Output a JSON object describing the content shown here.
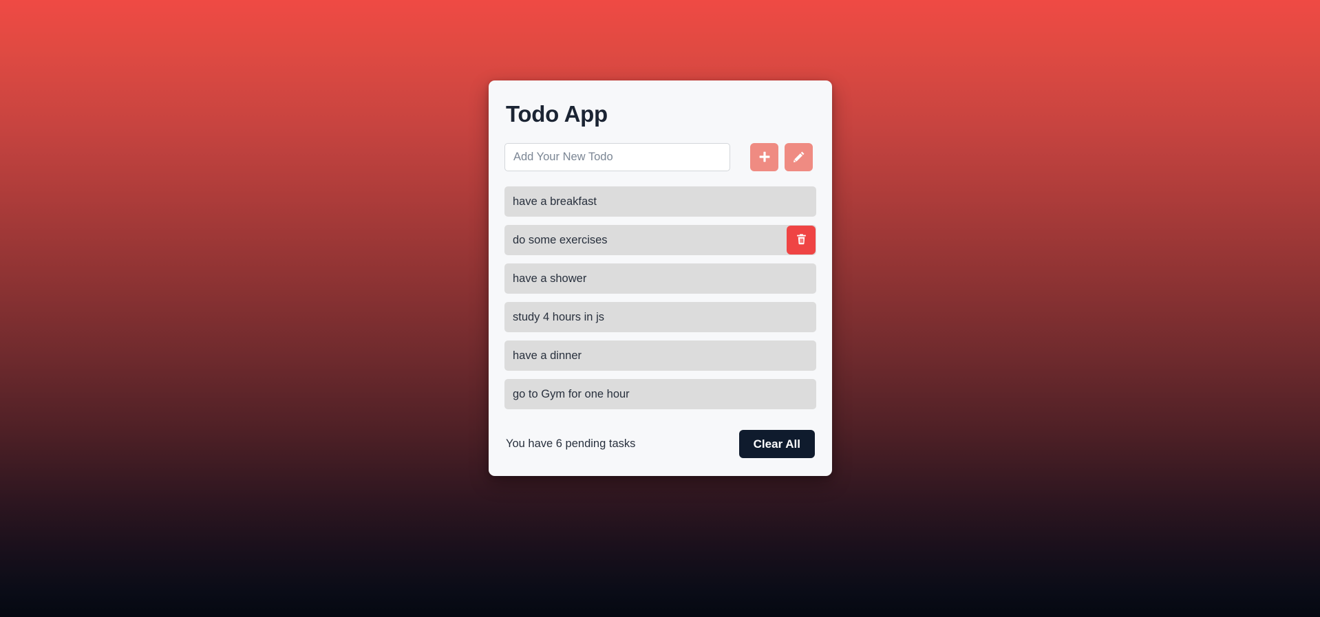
{
  "app": {
    "title": "Todo App",
    "background_top_color": "#ef4a44",
    "background_bottom_color": "#050811",
    "card_background": "#f7f8fa"
  },
  "add_form": {
    "input_value": "",
    "placeholder": "Add Your New Todo",
    "add_button_icon": "plus-icon",
    "edit_button_icon": "pencil-icon",
    "button_color": "#ef8b82"
  },
  "todos": [
    {
      "text": "have a breakfast",
      "hovered": false
    },
    {
      "text": "do some exercises",
      "hovered": true
    },
    {
      "text": "have a shower",
      "hovered": false
    },
    {
      "text": "study 4 hours in js",
      "hovered": false
    },
    {
      "text": "have a dinner",
      "hovered": false
    },
    {
      "text": "go to Gym for one hour",
      "hovered": false
    }
  ],
  "delete_button": {
    "icon": "trash-icon",
    "color": "#ef4444"
  },
  "footer": {
    "pending_text": "You have 6 pending tasks",
    "pending_count": 6,
    "clear_all_label": "Clear All",
    "clear_all_color": "#0f1b2d"
  }
}
